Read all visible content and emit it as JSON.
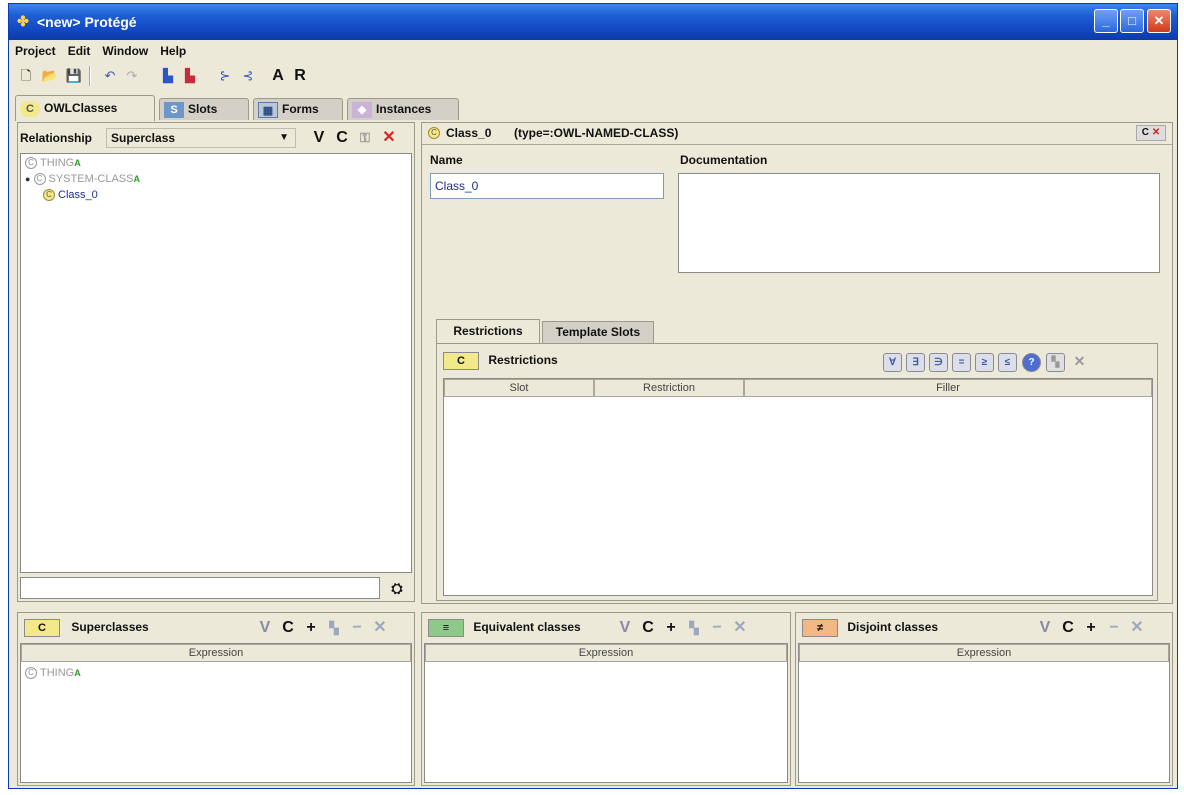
{
  "window": {
    "title": "<new> Protégé",
    "controls": {
      "minimize": "_",
      "maximize": "□",
      "close": "✕"
    }
  },
  "menubar": [
    "Project",
    "Edit",
    "Window",
    "Help"
  ],
  "toolbar": {
    "letter_a": "A",
    "letter_r": "R"
  },
  "tabs": [
    {
      "icon": "C",
      "label": "OWLClasses"
    },
    {
      "icon": "S",
      "label": "Slots"
    },
    {
      "icon": "▦",
      "label": "Forms"
    },
    {
      "icon": "◆",
      "label": "Instances"
    }
  ],
  "left_panel": {
    "relationship_label": "Relationship",
    "relationship_value": "Superclass",
    "buttons": {
      "v": "V",
      "c": "C"
    },
    "tree": [
      {
        "icon": "C",
        "label": "THING",
        "mark": "A"
      },
      {
        "icon": "C",
        "label": "SYSTEM-CLASS",
        "mark": "A"
      },
      {
        "icon": "C",
        "label": "Class_0",
        "mark": ""
      }
    ],
    "search_value": ""
  },
  "superclasses": {
    "icon": "C",
    "title": "Superclasses",
    "buttons": {
      "v": "V",
      "c": "C",
      "add": "+",
      "minus": "−",
      "close": "✕"
    },
    "column": "Expression",
    "rows": [
      {
        "label": "THING",
        "mark": "A"
      }
    ]
  },
  "class_panel": {
    "header_icon": "C",
    "header_name": "Class_0",
    "header_type": "(type=:OWL-NAMED-CLASS)",
    "corner_label": "C",
    "name_label": "Name",
    "name_value": "Class_0",
    "doc_label": "Documentation",
    "doc_value": ""
  },
  "subtabs": [
    "Restrictions",
    "Template Slots"
  ],
  "restrictions": {
    "icon": "C",
    "title": "Restrictions",
    "columns": [
      "Slot",
      "Restriction",
      "Filler"
    ],
    "icons": [
      "∀",
      "∃",
      "∋",
      "=",
      "≥",
      "≤"
    ],
    "help": "?",
    "close": "✕"
  },
  "equivalent": {
    "icon": "≡",
    "title": "Equivalent classes",
    "buttons": {
      "v": "V",
      "c": "C",
      "add": "+",
      "minus": "−",
      "close": "✕"
    },
    "column": "Expression"
  },
  "disjoint": {
    "icon": "≠",
    "title": "Disjoint classes",
    "buttons": {
      "v": "V",
      "c": "C",
      "add": "+",
      "minus": "−",
      "close": "✕"
    },
    "column": "Expression"
  }
}
